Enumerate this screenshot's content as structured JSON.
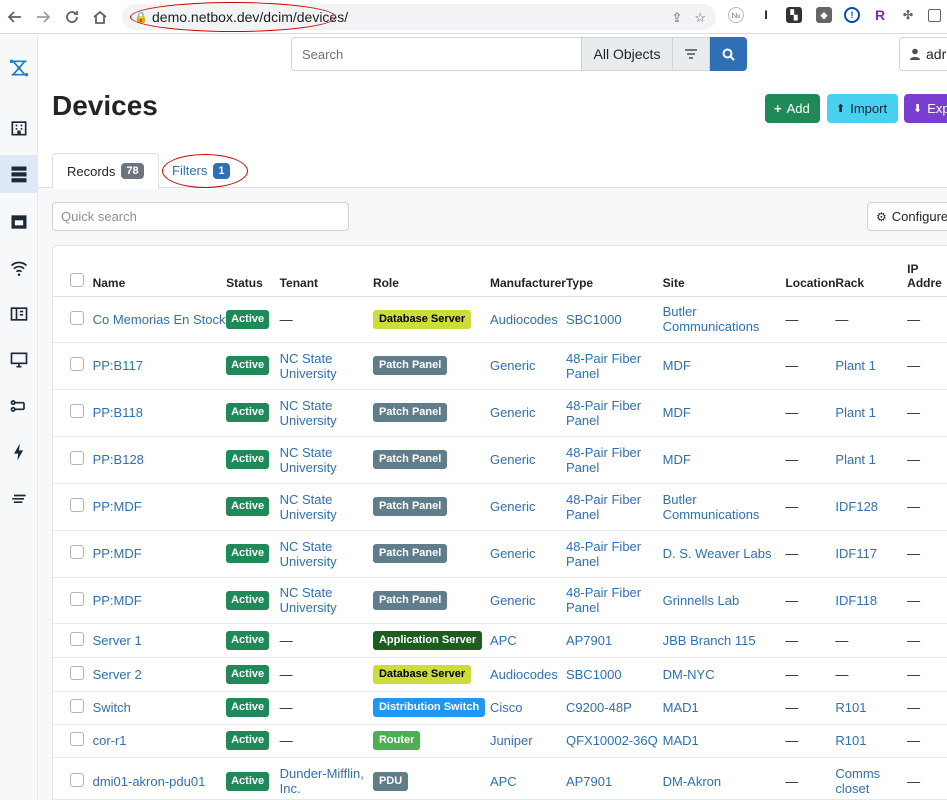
{
  "browser": {
    "url": "demo.netbox.dev/dcim/devices/"
  },
  "search": {
    "placeholder": "Search",
    "scope": "All Objects"
  },
  "user": {
    "label": "adr"
  },
  "page": {
    "title": "Devices",
    "add_label": "Add",
    "import_label": "Import",
    "export_label": "Exp"
  },
  "tabs": {
    "records_label": "Records",
    "records_count": "78",
    "filters_label": "Filters",
    "filters_count": "1"
  },
  "table_controls": {
    "quick_search_placeholder": "Quick search",
    "configure_label": "Configure"
  },
  "columns": [
    "Name",
    "Status",
    "Tenant",
    "Role",
    "Manufacturer",
    "Type",
    "Site",
    "Location",
    "Rack",
    "IP\nAddre"
  ],
  "colors": {
    "status_active": "#1f8a57",
    "role_database_server": "#cddc39",
    "role_patch_panel": "#607d8b",
    "role_application_server": "#1b5e20",
    "role_distribution_switch": "#2196f3",
    "role_router": "#4caf50",
    "role_pdu": "#607d8b",
    "link": "#2f6fb5"
  },
  "rows": [
    {
      "name": "Co Memorias En Stock",
      "status": "Active",
      "tenant": "—",
      "role": "Database Server",
      "role_color": "#cddc39",
      "role_text": "#000",
      "manufacturer": "Audiocodes",
      "type": "SBC1000",
      "site": "Butler Communications",
      "location": "—",
      "rack": "—",
      "ip": "—"
    },
    {
      "name": "PP:B117",
      "status": "Active",
      "tenant": "NC State University",
      "role": "Patch Panel",
      "role_color": "#607d8b",
      "role_text": "#fff",
      "manufacturer": "Generic",
      "type": "48-Pair Fiber Panel",
      "site": "MDF",
      "location": "—",
      "rack": "Plant 1",
      "ip": "—"
    },
    {
      "name": "PP:B118",
      "status": "Active",
      "tenant": "NC State University",
      "role": "Patch Panel",
      "role_color": "#607d8b",
      "role_text": "#fff",
      "manufacturer": "Generic",
      "type": "48-Pair Fiber Panel",
      "site": "MDF",
      "location": "—",
      "rack": "Plant 1",
      "ip": "—"
    },
    {
      "name": "PP:B128",
      "status": "Active",
      "tenant": "NC State University",
      "role": "Patch Panel",
      "role_color": "#607d8b",
      "role_text": "#fff",
      "manufacturer": "Generic",
      "type": "48-Pair Fiber Panel",
      "site": "MDF",
      "location": "—",
      "rack": "Plant 1",
      "ip": "—"
    },
    {
      "name": "PP:MDF",
      "status": "Active",
      "tenant": "NC State University",
      "role": "Patch Panel",
      "role_color": "#607d8b",
      "role_text": "#fff",
      "manufacturer": "Generic",
      "type": "48-Pair Fiber Panel",
      "site": "Butler Communications",
      "location": "—",
      "rack": "IDF128",
      "ip": "—"
    },
    {
      "name": "PP:MDF",
      "status": "Active",
      "tenant": "NC State University",
      "role": "Patch Panel",
      "role_color": "#607d8b",
      "role_text": "#fff",
      "manufacturer": "Generic",
      "type": "48-Pair Fiber Panel",
      "site": "D. S. Weaver Labs",
      "location": "—",
      "rack": "IDF117",
      "ip": "—"
    },
    {
      "name": "PP:MDF",
      "status": "Active",
      "tenant": "NC State University",
      "role": "Patch Panel",
      "role_color": "#607d8b",
      "role_text": "#fff",
      "manufacturer": "Generic",
      "type": "48-Pair Fiber Panel",
      "site": "Grinnells Lab",
      "location": "—",
      "rack": "IDF118",
      "ip": "—"
    },
    {
      "name": "Server 1",
      "status": "Active",
      "tenant": "—",
      "role": "Application Server",
      "role_color": "#1b5e20",
      "role_text": "#fff",
      "manufacturer": "APC",
      "type": "AP7901",
      "site": "JBB Branch 115",
      "location": "—",
      "rack": "—",
      "ip": "—"
    },
    {
      "name": "Server 2",
      "status": "Active",
      "tenant": "—",
      "role": "Database Server",
      "role_color": "#cddc39",
      "role_text": "#000",
      "manufacturer": "Audiocodes",
      "type": "SBC1000",
      "site": "DM-NYC",
      "location": "—",
      "rack": "—",
      "ip": "—"
    },
    {
      "name": "Switch",
      "status": "Active",
      "tenant": "—",
      "role": "Distribution Switch",
      "role_color": "#2196f3",
      "role_text": "#fff",
      "manufacturer": "Cisco",
      "type": "C9200-48P",
      "site": "MAD1",
      "location": "—",
      "rack": "R101",
      "ip": "—"
    },
    {
      "name": "cor-r1",
      "status": "Active",
      "tenant": "—",
      "role": "Router",
      "role_color": "#4caf50",
      "role_text": "#fff",
      "manufacturer": "Juniper",
      "type": "QFX10002-36Q",
      "site": "MAD1",
      "location": "—",
      "rack": "R101",
      "ip": "—"
    },
    {
      "name": "dmi01-akron-pdu01",
      "status": "Active",
      "tenant": "Dunder-Mifflin, Inc.",
      "role": "PDU",
      "role_color": "#607d8b",
      "role_text": "#fff",
      "manufacturer": "APC",
      "type": "AP7901",
      "site": "DM-Akron",
      "location": "—",
      "rack": "Comms closet",
      "ip": "—"
    }
  ]
}
